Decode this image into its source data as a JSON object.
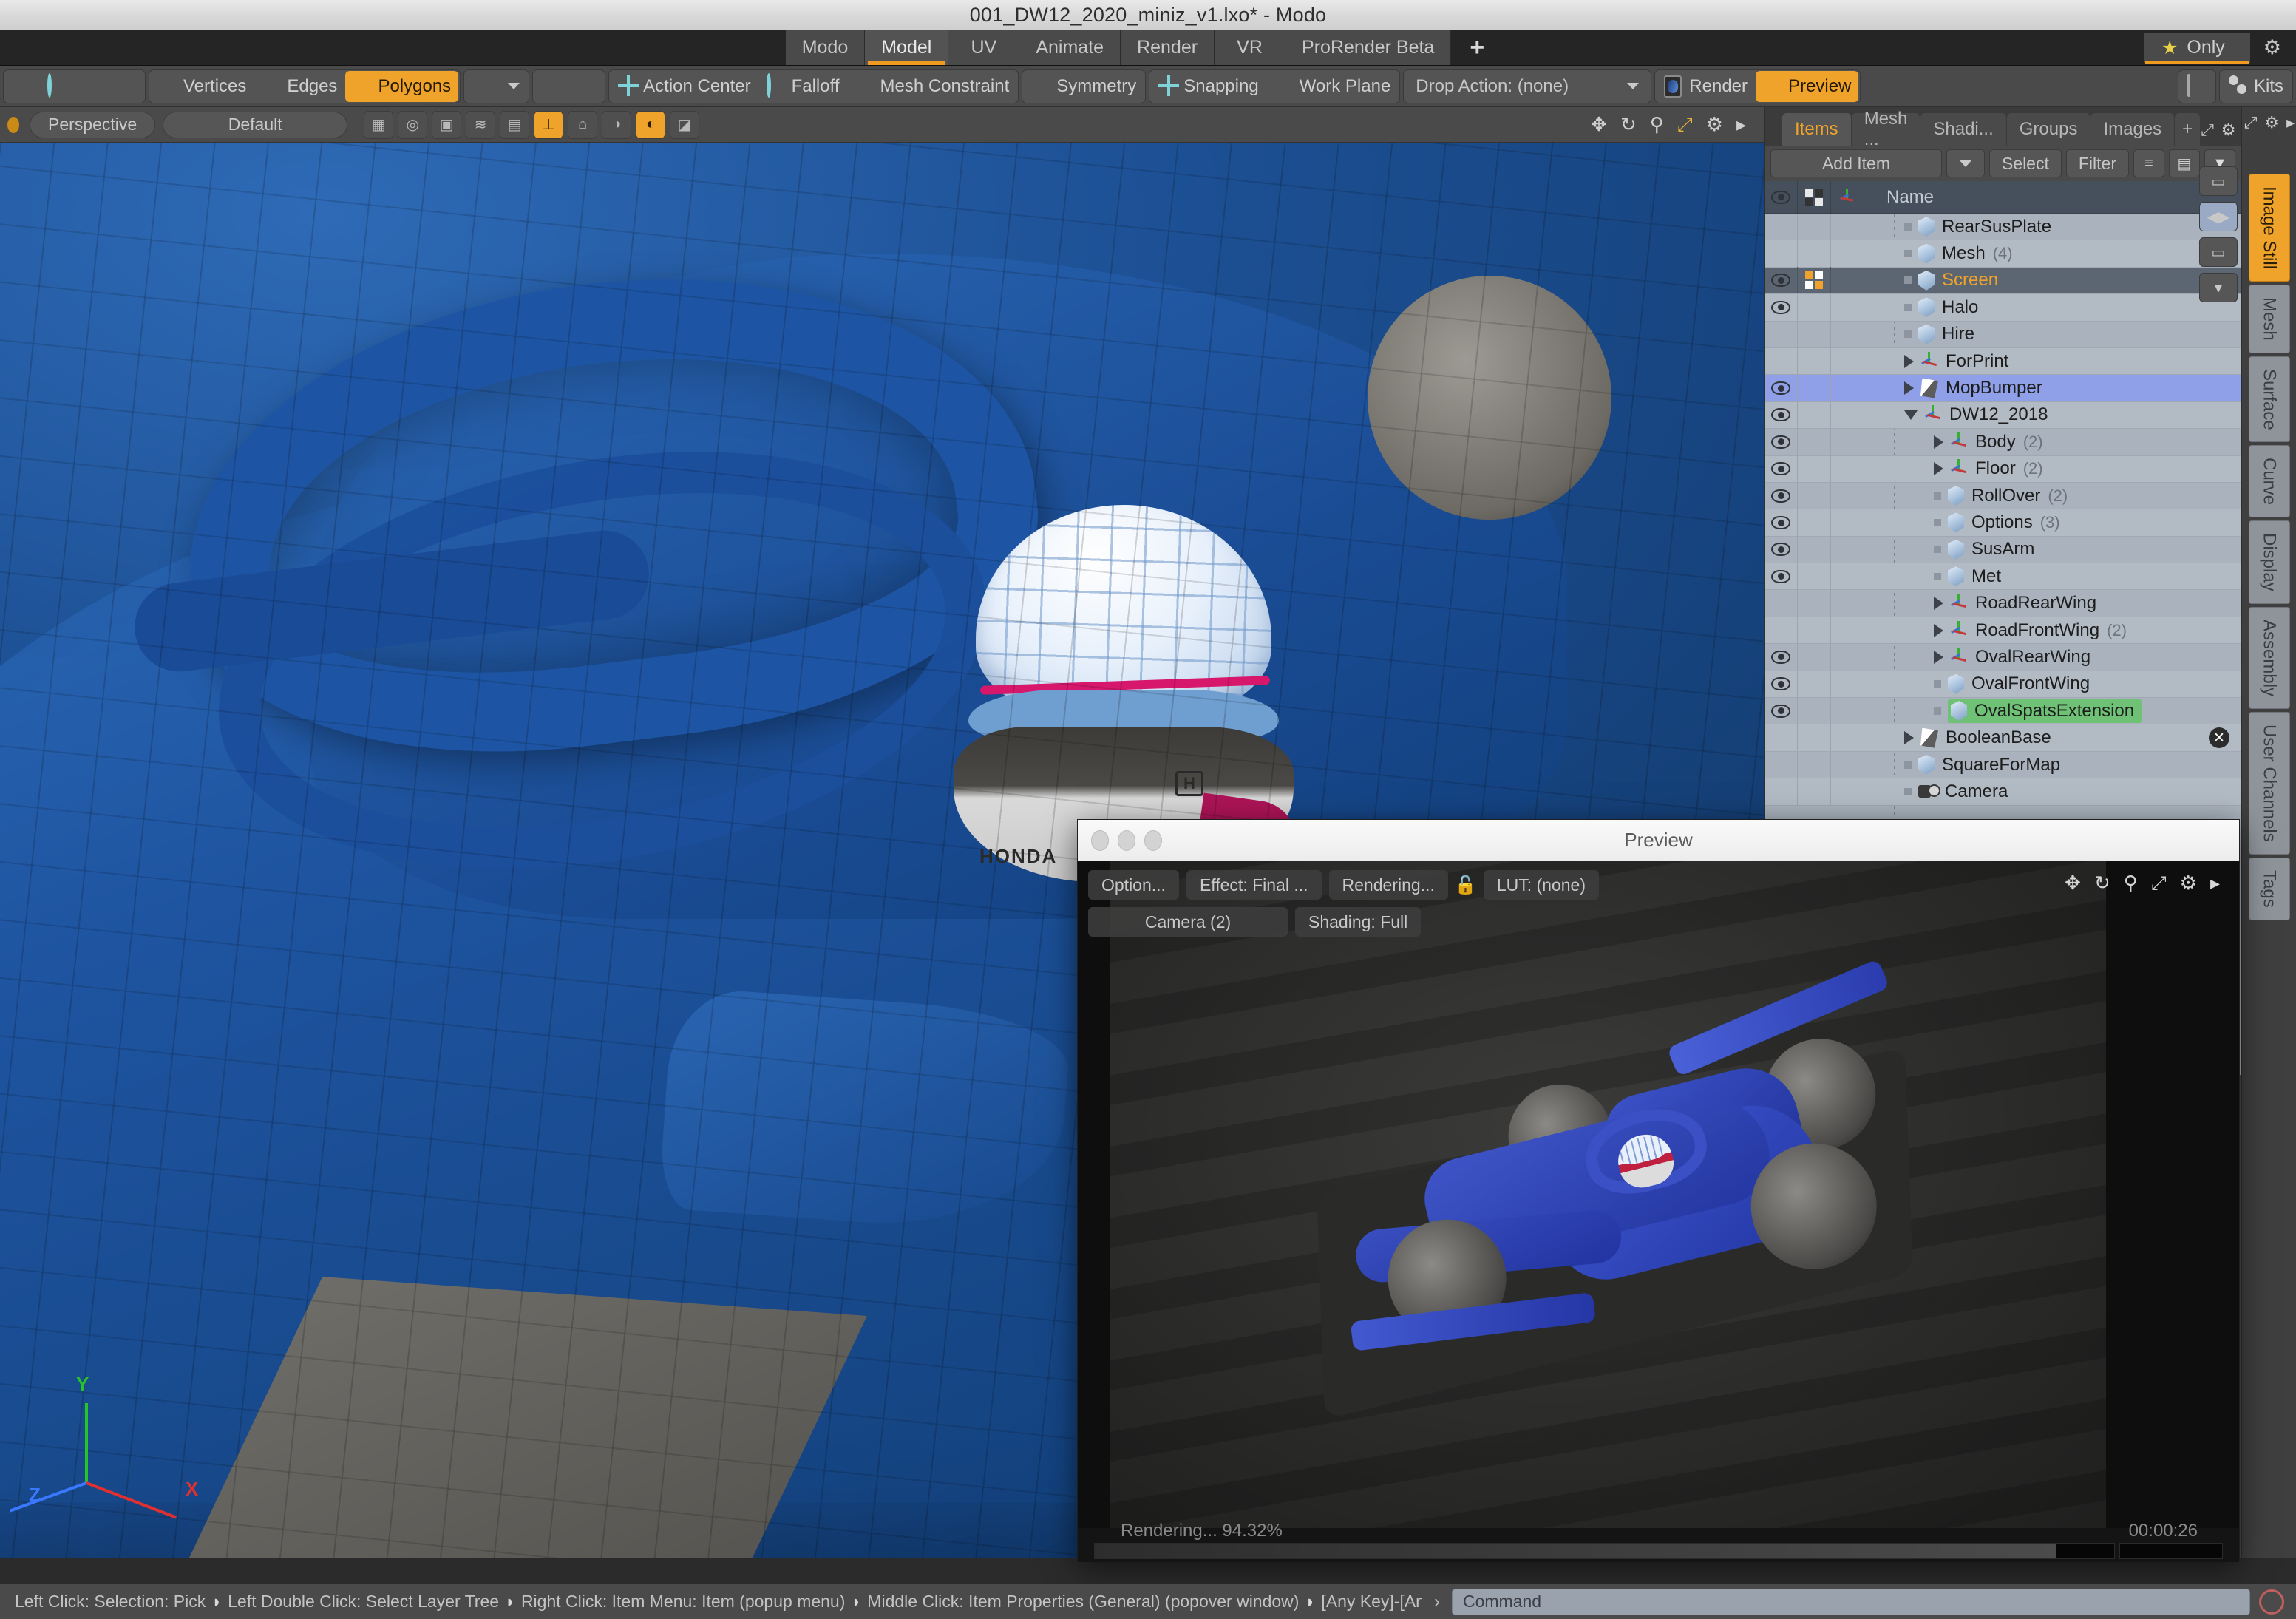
{
  "window": {
    "title": "001_DW12_2020_miniz_v1.lxo* - Modo"
  },
  "top_tabs": {
    "items": [
      "Modo",
      "Model",
      "UV",
      "Animate",
      "Render",
      "VR",
      "ProRender Beta"
    ],
    "active": "Model",
    "add_label": "+",
    "only_label": "Only",
    "star_icon": "star-icon",
    "gear_icon": "gear-icon"
  },
  "toolbar": {
    "vertices": "Vertices",
    "edges": "Edges",
    "polygons": "Polygons",
    "action_center": "Action Center",
    "falloff": "Falloff",
    "mesh_constraint": "Mesh Constraint",
    "symmetry": "Symmetry",
    "snapping": "Snapping",
    "work_plane": "Work Plane",
    "drop_action": "Drop Action: (none)",
    "render": "Render",
    "preview": "Preview",
    "kits": "Kits",
    "accent_color": "#f0a32a"
  },
  "viewport": {
    "projection": "Perspective",
    "style": "Default",
    "axis_labels": {
      "x": "X",
      "y": "Y",
      "z": "Z"
    },
    "icons": [
      "move-icon",
      "rotate-icon",
      "zoom-icon",
      "fit-icon",
      "gear-icon",
      "chevron-right-icon"
    ],
    "model_colors": {
      "body": "#1d4f92",
      "floor": "#6a6a66",
      "accent_red": "#b02a2a"
    }
  },
  "right_panel": {
    "tabs": [
      "Items",
      "Mesh ...",
      "Shadi...",
      "Groups",
      "Images"
    ],
    "active_tab": "Items",
    "add_tab": "+",
    "add_item": "Add Item",
    "select": "Select",
    "filter": "Filter",
    "tree_header": {
      "eye": "visibility-icon",
      "select": "selection-icon",
      "axis": "transform-icon",
      "name": "Name"
    },
    "items": [
      {
        "name": "RearSusPlate",
        "count": "",
        "icon": "mesh-icon",
        "indent": 1,
        "eye": false,
        "sel": false,
        "expander": "dot",
        "state": "normal"
      },
      {
        "name": "Mesh",
        "count": "(4)",
        "icon": "mesh-icon",
        "indent": 1,
        "eye": false,
        "sel": false,
        "expander": "dot",
        "state": "normal"
      },
      {
        "name": "Screen",
        "count": "",
        "icon": "mesh-icon",
        "indent": 1,
        "eye": true,
        "sel": true,
        "expander": "dot",
        "state": "active"
      },
      {
        "name": "Halo",
        "count": "",
        "icon": "mesh-icon",
        "indent": 1,
        "eye": true,
        "sel": false,
        "expander": "dot",
        "state": "normal"
      },
      {
        "name": "Hire",
        "count": "",
        "icon": "mesh-icon",
        "indent": 1,
        "eye": false,
        "sel": false,
        "expander": "dot",
        "state": "normal"
      },
      {
        "name": "ForPrint",
        "count": "",
        "icon": "locator-icon",
        "indent": 1,
        "eye": false,
        "sel": false,
        "expander": "right",
        "state": "normal"
      },
      {
        "name": "MopBumper",
        "count": "",
        "icon": "boolean-icon",
        "indent": 1,
        "eye": true,
        "sel": false,
        "expander": "right",
        "state": "selected-blue"
      },
      {
        "name": "DW12_2018",
        "count": "",
        "icon": "locator-icon",
        "indent": 1,
        "eye": true,
        "sel": false,
        "expander": "down",
        "state": "normal"
      },
      {
        "name": "Body",
        "count": "(2)",
        "icon": "locator-icon",
        "indent": 2,
        "eye": true,
        "sel": false,
        "expander": "right",
        "state": "normal"
      },
      {
        "name": "Floor",
        "count": "(2)",
        "icon": "locator-icon",
        "indent": 2,
        "eye": true,
        "sel": false,
        "expander": "right",
        "state": "normal"
      },
      {
        "name": "RollOver",
        "count": "(2)",
        "icon": "mesh-icon",
        "indent": 2,
        "eye": true,
        "sel": false,
        "expander": "dot",
        "state": "normal"
      },
      {
        "name": "Options",
        "count": "(3)",
        "icon": "mesh-icon",
        "indent": 2,
        "eye": true,
        "sel": false,
        "expander": "dot",
        "state": "normal"
      },
      {
        "name": "SusArm",
        "count": "",
        "icon": "mesh-icon",
        "indent": 2,
        "eye": true,
        "sel": false,
        "expander": "dot",
        "state": "normal"
      },
      {
        "name": "Met",
        "count": "",
        "icon": "mesh-icon",
        "indent": 2,
        "eye": true,
        "sel": false,
        "expander": "dot",
        "state": "normal"
      },
      {
        "name": "RoadRearWing",
        "count": "",
        "icon": "locator-icon",
        "indent": 2,
        "eye": false,
        "sel": false,
        "expander": "right",
        "state": "normal"
      },
      {
        "name": "RoadFrontWing",
        "count": "(2)",
        "icon": "locator-icon",
        "indent": 2,
        "eye": false,
        "sel": false,
        "expander": "right",
        "state": "normal"
      },
      {
        "name": "OvalRearWing",
        "count": "",
        "icon": "locator-icon",
        "indent": 2,
        "eye": true,
        "sel": false,
        "expander": "right",
        "state": "normal"
      },
      {
        "name": "OvalFrontWing",
        "count": "",
        "icon": "mesh-icon",
        "indent": 2,
        "eye": true,
        "sel": false,
        "expander": "dot",
        "state": "normal"
      },
      {
        "name": "OvalSpatsExtension",
        "count": "",
        "icon": "mesh-icon",
        "indent": 2,
        "eye": true,
        "sel": false,
        "expander": "dot",
        "state": "selected-green"
      },
      {
        "name": "BooleanBase",
        "count": "",
        "icon": "boolean-icon",
        "indent": 1,
        "eye": false,
        "sel": false,
        "expander": "right",
        "state": "normal",
        "close": true
      },
      {
        "name": "SquareForMap",
        "count": "",
        "icon": "mesh-icon",
        "indent": 1,
        "eye": false,
        "sel": false,
        "expander": "dot",
        "state": "normal"
      },
      {
        "name": "Camera",
        "count": "",
        "icon": "camera-icon",
        "indent": 1,
        "eye": false,
        "sel": false,
        "expander": "dot",
        "state": "normal"
      }
    ]
  },
  "vertical_tabs": {
    "items": [
      "Image Still",
      "Mesh",
      "Surface",
      "Curve",
      "Display",
      "Assembly",
      "User Channels",
      "Tags"
    ],
    "active": "Image Still"
  },
  "preview_window": {
    "title": "Preview",
    "buttons": {
      "options": "Option...",
      "effect": "Effect: Final ...",
      "rendering": "Rendering...",
      "lut": "LUT: (none)",
      "camera": "Camera (2)",
      "shading": "Shading: Full"
    },
    "lock_icon": "unlock-icon",
    "status": "Rendering... 94.32%",
    "time": "00:00:26",
    "progress_percent": 94.32,
    "icons": [
      "move-icon",
      "rotate-icon",
      "zoom-icon",
      "fit-icon",
      "gear-icon",
      "chevron-right-icon"
    ]
  },
  "status_bar": {
    "hints": [
      "Left Click: Selection: Pick",
      "Left Double Click: Select Layer Tree",
      "Right Click: Item Menu: Item (popup menu)",
      "Middle Click: Item Properties (General) (popover window)",
      "[Any Key]-[Any Button] Click: Special Behavio ..."
    ],
    "chevron": "›",
    "command_placeholder": "Command",
    "stop_icon": "stop-icon"
  }
}
